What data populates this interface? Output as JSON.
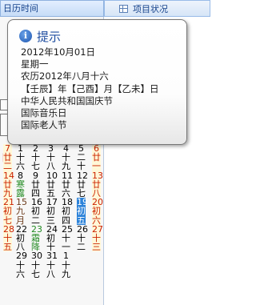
{
  "header": {
    "left_title": "日历时间",
    "right_tab_icon": "grid-icon",
    "right_tab_label": "项目状况"
  },
  "tooltip": {
    "icon": "info-icon",
    "title": "提示",
    "lines": [
      "2012年10月01日",
      "星期一",
      "农历2012年八月十六",
      "【壬辰】年【己酉】月【乙未】日",
      "中华人民共和国国庆节",
      "国际音乐日",
      "国际老人节"
    ]
  },
  "stubs": {
    "red_text": "日"
  },
  "calendar": {
    "columns": [
      {
        "cells": [
          {
            "t": "",
            "c": "black"
          },
          {
            "t": "",
            "c": "black"
          },
          {
            "t": "",
            "c": "black"
          },
          {
            "t": "",
            "c": "black"
          },
          {
            "t": "7",
            "c": "red"
          },
          {
            "t": "廿",
            "c": "red"
          },
          {
            "t": "二",
            "c": "red"
          },
          {
            "t": "14",
            "c": "red"
          },
          {
            "t": "廿",
            "c": "red"
          },
          {
            "t": "九",
            "c": "red"
          },
          {
            "t": "21",
            "c": "red"
          },
          {
            "t": "初",
            "c": "red"
          },
          {
            "t": "七",
            "c": "red"
          },
          {
            "t": "28",
            "c": "red"
          },
          {
            "t": "十",
            "c": "red"
          },
          {
            "t": "五",
            "c": "red"
          }
        ]
      },
      {
        "cells": [
          {
            "t": "1",
            "c": "black"
          },
          {
            "t": "十",
            "c": "black"
          },
          {
            "t": "六",
            "c": "black"
          },
          {
            "t": "8",
            "c": "black"
          },
          {
            "t": "寒",
            "c": "green"
          },
          {
            "t": "露",
            "c": "green"
          },
          {
            "t": "15",
            "c": "dark"
          },
          {
            "t": "九",
            "c": "dark"
          },
          {
            "t": "月",
            "c": "dark"
          },
          {
            "t": "22",
            "c": "black"
          },
          {
            "t": "初",
            "c": "black"
          },
          {
            "t": "八",
            "c": "black"
          },
          {
            "t": "29",
            "c": "black"
          },
          {
            "t": "十",
            "c": "black"
          },
          {
            "t": "六",
            "c": "black"
          }
        ]
      },
      {
        "cells": [
          {
            "t": "2",
            "c": "black"
          },
          {
            "t": "十",
            "c": "black"
          },
          {
            "t": "七",
            "c": "black"
          },
          {
            "t": "9",
            "c": "black"
          },
          {
            "t": "廿",
            "c": "black"
          },
          {
            "t": "四",
            "c": "black"
          },
          {
            "t": "16",
            "c": "black"
          },
          {
            "t": "初",
            "c": "black"
          },
          {
            "t": "二",
            "c": "black"
          },
          {
            "t": "23",
            "c": "green"
          },
          {
            "t": "霜",
            "c": "green"
          },
          {
            "t": "降",
            "c": "green"
          },
          {
            "t": "30",
            "c": "black"
          },
          {
            "t": "十",
            "c": "black"
          },
          {
            "t": "七",
            "c": "black"
          }
        ]
      },
      {
        "cells": [
          {
            "t": "3",
            "c": "black"
          },
          {
            "t": "十",
            "c": "black"
          },
          {
            "t": "八",
            "c": "black"
          },
          {
            "t": "10",
            "c": "black"
          },
          {
            "t": "廿",
            "c": "black"
          },
          {
            "t": "五",
            "c": "black"
          },
          {
            "t": "17",
            "c": "black"
          },
          {
            "t": "初",
            "c": "black"
          },
          {
            "t": "三",
            "c": "black"
          },
          {
            "t": "24",
            "c": "black"
          },
          {
            "t": "初",
            "c": "black"
          },
          {
            "t": "十",
            "c": "black"
          },
          {
            "t": "31",
            "c": "black"
          },
          {
            "t": "十",
            "c": "black"
          },
          {
            "t": "八",
            "c": "black"
          }
        ]
      },
      {
        "cells": [
          {
            "t": "4",
            "c": "black"
          },
          {
            "t": "十",
            "c": "black"
          },
          {
            "t": "九",
            "c": "black"
          },
          {
            "t": "11",
            "c": "black"
          },
          {
            "t": "廿",
            "c": "black"
          },
          {
            "t": "六",
            "c": "black"
          },
          {
            "t": "18",
            "c": "black"
          },
          {
            "t": "初",
            "c": "black"
          },
          {
            "t": "四",
            "c": "black"
          },
          {
            "t": "25",
            "c": "black"
          },
          {
            "t": "十",
            "c": "black"
          },
          {
            "t": "一",
            "c": "black"
          },
          {
            "t": "1",
            "c": "black"
          },
          {
            "t": "十",
            "c": "black"
          },
          {
            "t": "九",
            "c": "black"
          }
        ]
      },
      {
        "cells": [
          {
            "t": "5",
            "c": "black"
          },
          {
            "t": "二",
            "c": "black"
          },
          {
            "t": "十",
            "c": "black"
          },
          {
            "t": "12",
            "c": "black"
          },
          {
            "t": "廿",
            "c": "black"
          },
          {
            "t": "七",
            "c": "black"
          },
          {
            "t": "19",
            "c": "selected"
          },
          {
            "t": "初",
            "c": "selected"
          },
          {
            "t": "五",
            "c": "selected"
          },
          {
            "t": "26",
            "c": "black"
          },
          {
            "t": "十",
            "c": "black"
          },
          {
            "t": "二",
            "c": "black"
          },
          {
            "t": "",
            "c": "black"
          },
          {
            "t": "",
            "c": "black"
          },
          {
            "t": "",
            "c": "black"
          }
        ]
      },
      {
        "cells": [
          {
            "t": "6",
            "c": "red"
          },
          {
            "t": "廿",
            "c": "red"
          },
          {
            "t": "一",
            "c": "red"
          },
          {
            "t": "13",
            "c": "red"
          },
          {
            "t": "廿",
            "c": "red"
          },
          {
            "t": "八",
            "c": "red"
          },
          {
            "t": "20",
            "c": "red"
          },
          {
            "t": "初",
            "c": "red"
          },
          {
            "t": "六",
            "c": "red"
          },
          {
            "t": "27",
            "c": "red"
          },
          {
            "t": "十",
            "c": "red"
          },
          {
            "t": "三",
            "c": "red"
          },
          {
            "t": "",
            "c": "black"
          },
          {
            "t": "",
            "c": "black"
          },
          {
            "t": "",
            "c": "black"
          }
        ]
      }
    ]
  }
}
